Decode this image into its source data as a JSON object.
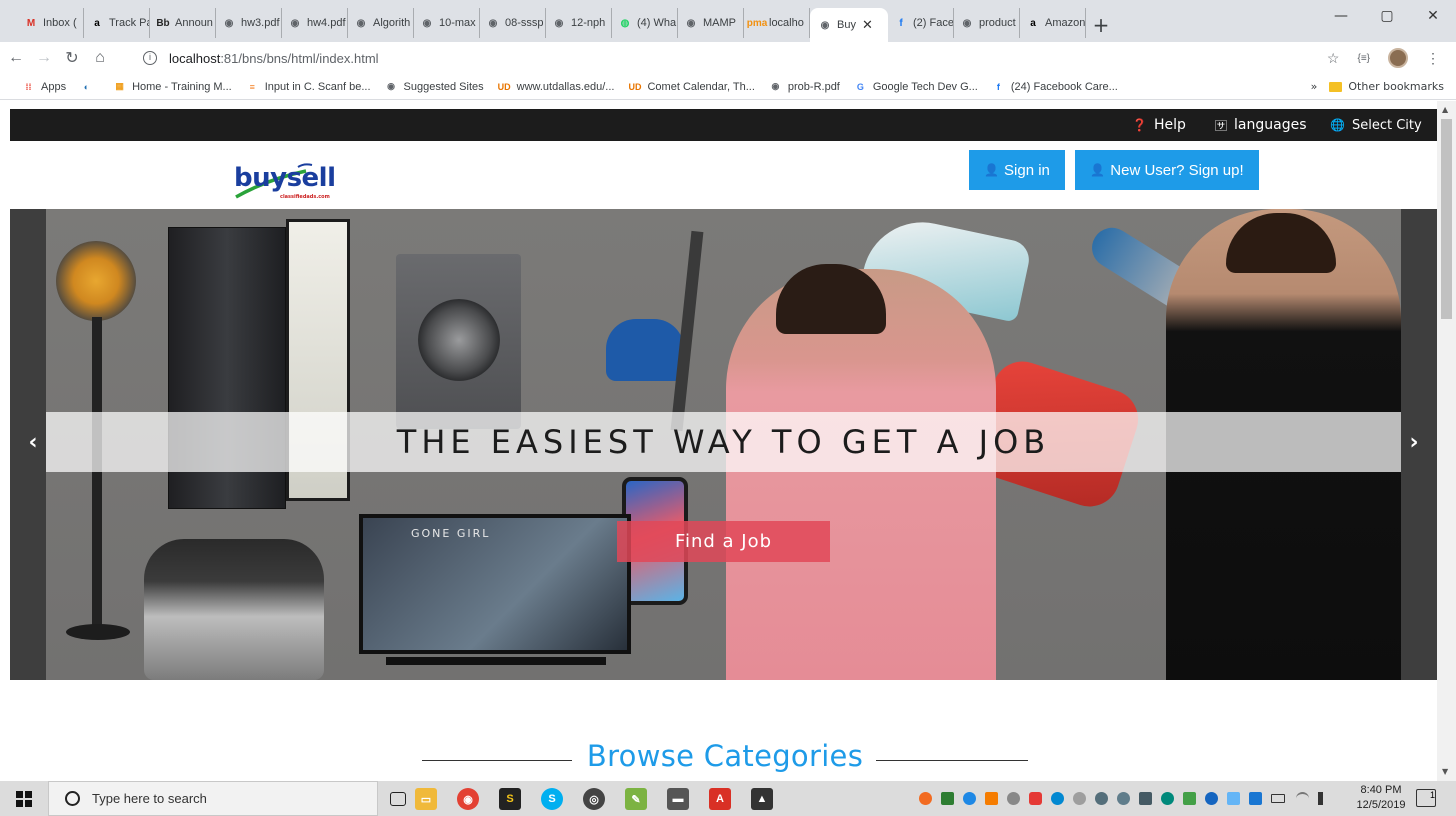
{
  "browser": {
    "tabs": [
      {
        "label": "Inbox (",
        "icon": "gmail-icon",
        "color": "#d93025",
        "glyph": "M"
      },
      {
        "label": "Track Pa",
        "icon": "amazon-icon",
        "color": "#000000",
        "glyph": "a"
      },
      {
        "label": "Announ",
        "icon": "blackboard-icon",
        "color": "#262626",
        "glyph": "Bb"
      },
      {
        "label": "hw3.pdf",
        "icon": "globe-icon",
        "color": "#5f6368",
        "glyph": "◉"
      },
      {
        "label": "hw4.pdf",
        "icon": "globe-icon",
        "color": "#5f6368",
        "glyph": "◉"
      },
      {
        "label": "Algorith",
        "icon": "globe-icon",
        "color": "#5f6368",
        "glyph": "◉"
      },
      {
        "label": "10-max",
        "icon": "globe-icon",
        "color": "#5f6368",
        "glyph": "◉"
      },
      {
        "label": "08-sssp",
        "icon": "globe-icon",
        "color": "#5f6368",
        "glyph": "◉"
      },
      {
        "label": "12-nph",
        "icon": "globe-icon",
        "color": "#5f6368",
        "glyph": "◉"
      },
      {
        "label": "(4) Wha",
        "icon": "whatsapp-icon",
        "color": "#25d366",
        "glyph": "◍"
      },
      {
        "label": "MAMP",
        "icon": "globe-icon",
        "color": "#5f6368",
        "glyph": "◉"
      },
      {
        "label": "localho",
        "icon": "phpmyadmin-icon",
        "color": "#f29111",
        "glyph": "pma"
      },
      {
        "label": "Buy",
        "icon": "globe-icon",
        "color": "#5f6368",
        "glyph": "◉",
        "active": true
      },
      {
        "label": "(2) Face",
        "icon": "facebook-icon",
        "color": "#1877f2",
        "glyph": "f"
      },
      {
        "label": "product",
        "icon": "globe-icon",
        "color": "#5f6368",
        "glyph": "◉"
      },
      {
        "label": "Amazon",
        "icon": "amazon-icon",
        "color": "#000000",
        "glyph": "a"
      }
    ],
    "new_tab": "+",
    "url_host": "localhost",
    "url_path": ":81/bns/bns/html/index.html",
    "bookmarks": [
      {
        "label": "Apps",
        "icon": "apps-grid-icon",
        "color": "#ea4335",
        "glyph": "⁞⁞"
      },
      {
        "label": "",
        "icon": "skills-icon",
        "color": "#1f6fb2",
        "glyph": "◐"
      },
      {
        "label": "Home - Training M...",
        "icon": "training-icon",
        "color": "#f0a020",
        "glyph": "▦"
      },
      {
        "label": "Input in C. Scanf be...",
        "icon": "stackoverflow-icon",
        "color": "#f48024",
        "glyph": "≡"
      },
      {
        "label": "Suggested Sites",
        "icon": "globe-icon",
        "color": "#5f6368",
        "glyph": "◉"
      },
      {
        "label": "www.utdallas.edu/...",
        "icon": "utd-icon",
        "color": "#e87500",
        "glyph": "UD"
      },
      {
        "label": "Comet Calendar, Th...",
        "icon": "utd-icon",
        "color": "#e87500",
        "glyph": "UD"
      },
      {
        "label": "prob-R.pdf",
        "icon": "globe-icon",
        "color": "#5f6368",
        "glyph": "◉"
      },
      {
        "label": "Google Tech Dev G...",
        "icon": "google-icon",
        "color": "#4285f4",
        "glyph": "G"
      },
      {
        "label": "(24) Facebook Care...",
        "icon": "facebook-icon",
        "color": "#1877f2",
        "glyph": "f"
      }
    ],
    "more_bookmarks": "»",
    "other_bookmarks": "Other bookmarks"
  },
  "topbar": {
    "help": "Help",
    "languages": "languages",
    "city": "Select City"
  },
  "header": {
    "logo_text": "buysell",
    "logo_sub": "classifiedads.com",
    "signin": "Sign in",
    "signup": "New User? Sign up!"
  },
  "hero": {
    "title": "THE EASIEST WAY TO GET A JOB",
    "cta": "Find a Job",
    "tv_text": "GONE GIRL",
    "prev": "‹",
    "next": "›"
  },
  "section": {
    "title": "Browse Categories"
  },
  "taskbar": {
    "search_placeholder": "Type here to search",
    "time": "8:40 PM",
    "date": "12/5/2019",
    "notification_count": "1"
  },
  "colors": {
    "accent": "#1e9be8",
    "cta": "#e14858",
    "topbar": "#1c1c1c"
  }
}
